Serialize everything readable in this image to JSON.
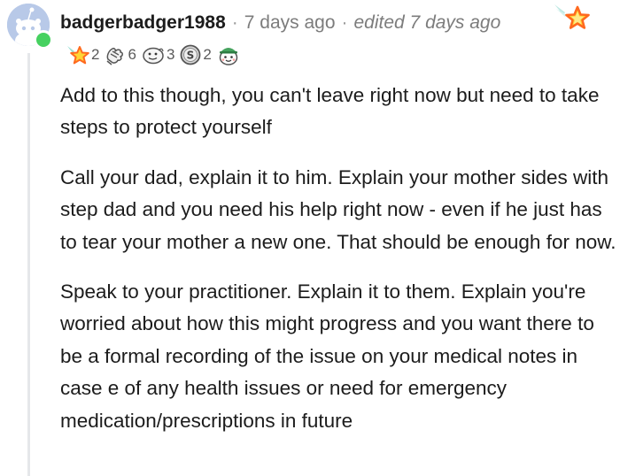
{
  "comment": {
    "author": "badgerbadger1988",
    "separator": "·",
    "time": "7 days ago",
    "edited": "edited 7 days ago",
    "awards": [
      {
        "icon": "starstruck-award-icon",
        "count": "2"
      },
      {
        "icon": "bravo-award-icon",
        "count": "6"
      },
      {
        "icon": "face-award-icon",
        "count": "3"
      },
      {
        "icon": "silver-coin-award-icon",
        "count": "2"
      },
      {
        "icon": "wholesome-seal-award-icon",
        "count": ""
      }
    ],
    "paragraphs": [
      "Add to this though, you can't leave right now but need to take steps to protect yourself",
      "Call your dad, explain it to him. Explain your mother sides with step dad and you need his help right now - even if he just has to tear your mother a new one. That should be enough for now.",
      "Speak to your practitioner. Explain it to them. Explain you're worried about how this might progress and you want there to be a formal recording of the issue on your medical notes in case e of any health issues or need for emergency medication/prescriptions in future"
    ]
  },
  "colors": {
    "online": "#46d160",
    "avatar_bg": "#b8c9e8",
    "thread_line": "#e5e7ea",
    "text": "#1c1c1c",
    "meta": "#7c7c7c"
  }
}
